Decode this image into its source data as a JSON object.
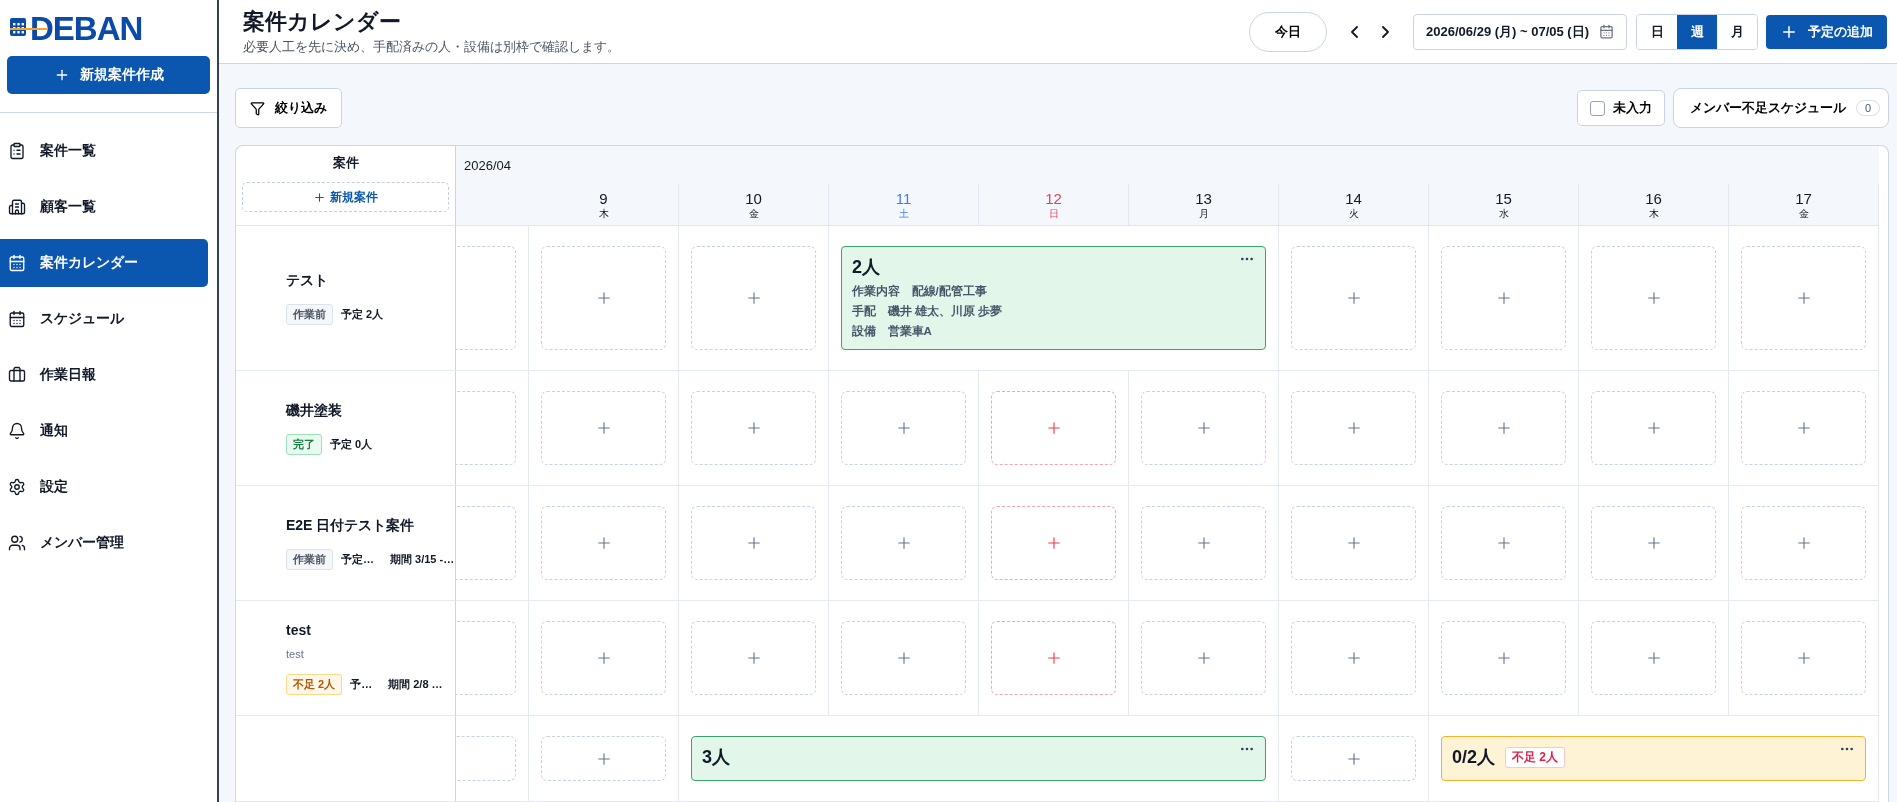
{
  "sidebar": {
    "logo": "DEBAN",
    "new_button": "新規案件作成",
    "items": [
      {
        "label": "案件一覧",
        "kind": "clipboard",
        "selected": false
      },
      {
        "label": "顧客一覧",
        "kind": "building",
        "selected": false
      },
      {
        "label": "案件カレンダー",
        "kind": "calendar",
        "selected": true
      },
      {
        "label": "スケジュール",
        "kind": "calendar",
        "selected": false
      },
      {
        "label": "作業日報",
        "kind": "briefcase",
        "selected": false
      },
      {
        "label": "通知",
        "kind": "bell",
        "selected": false
      },
      {
        "label": "設定",
        "kind": "gear",
        "selected": false
      },
      {
        "label": "メンバー管理",
        "kind": "users",
        "selected": false
      }
    ]
  },
  "header": {
    "title": "案件カレンダー",
    "subtitle": "必要人工を先に決め、手配済みの人・設備は別枠で確認します。",
    "today": "今日",
    "date_range": "2026/06/29 (月) ~ 07/05 (日)",
    "views": [
      {
        "label": "日",
        "selected": false
      },
      {
        "label": "週",
        "selected": true
      },
      {
        "label": "月",
        "selected": false
      }
    ],
    "add_button": "予定の追加"
  },
  "toolbar": {
    "filter": "絞り込み",
    "unfilled": {
      "label": "未入力",
      "checked": false
    },
    "shortage": {
      "label": "メンバー不足スケジュール",
      "count": "0"
    }
  },
  "calendar": {
    "project_heading": "案件",
    "new_project": "新規案件",
    "month": "2026/04",
    "days": [
      {
        "day": "9",
        "weekday": "木",
        "kind": "weekday"
      },
      {
        "day": "10",
        "weekday": "金",
        "kind": "weekday"
      },
      {
        "day": "11",
        "weekday": "土",
        "kind": "saturday"
      },
      {
        "day": "12",
        "weekday": "日",
        "kind": "sunday"
      },
      {
        "day": "13",
        "weekday": "月",
        "kind": "weekday"
      },
      {
        "day": "14",
        "weekday": "火",
        "kind": "weekday"
      },
      {
        "day": "15",
        "weekday": "水",
        "kind": "weekday"
      },
      {
        "day": "16",
        "weekday": "木",
        "kind": "weekday"
      },
      {
        "day": "17",
        "weekday": "金",
        "kind": "weekday"
      }
    ],
    "rows": [
      {
        "name": "テスト",
        "status": {
          "label": "作業前",
          "kind": "before"
        },
        "planned": "予定 2人",
        "cells": [
          {
            "kind": "slot"
          },
          {
            "kind": "slot"
          },
          {
            "kind": "event_ok",
            "title": "2人",
            "lines": [
              {
                "label": "作業内容",
                "value": "配線/配管工事"
              },
              {
                "label": "手配",
                "value": "磯井 雄太、川原 歩夢"
              },
              {
                "label": "設備",
                "value": "営業車A"
              }
            ]
          },
          {
            "kind": "more"
          },
          {
            "kind": "more"
          },
          {
            "kind": "slot"
          },
          {
            "kind": "slot"
          },
          {
            "kind": "slot"
          },
          {
            "kind": "slot"
          }
        ]
      },
      {
        "name": "磯井塗装",
        "status": {
          "label": "完了",
          "kind": "done"
        },
        "planned": "予定 0人",
        "cells": [
          {
            "kind": "slot"
          },
          {
            "kind": "slot"
          },
          {
            "kind": "slot"
          },
          {
            "kind": "slot"
          },
          {
            "kind": "slot"
          },
          {
            "kind": "slot"
          },
          {
            "kind": "slot"
          },
          {
            "kind": "slot"
          },
          {
            "kind": "slot"
          }
        ]
      },
      {
        "name": "E2E 日付テスト案件",
        "status": {
          "label": "作業前",
          "kind": "before"
        },
        "planned": "予定…",
        "period": "期間 3/15 -…",
        "cells": [
          {
            "kind": "slot"
          },
          {
            "kind": "slot"
          },
          {
            "kind": "slot"
          },
          {
            "kind": "slot"
          },
          {
            "kind": "slot"
          },
          {
            "kind": "slot"
          },
          {
            "kind": "slot"
          },
          {
            "kind": "slot"
          },
          {
            "kind": "slot"
          }
        ]
      },
      {
        "name": "test",
        "note": "test",
        "status": {
          "label": "不足 2人",
          "kind": "short"
        },
        "planned": "予…",
        "period": "期間 2/8 …",
        "cells": [
          {
            "kind": "slot"
          },
          {
            "kind": "slot"
          },
          {
            "kind": "slot"
          },
          {
            "kind": "slot"
          },
          {
            "kind": "slot"
          },
          {
            "kind": "slot"
          },
          {
            "kind": "slot"
          },
          {
            "kind": "slot"
          },
          {
            "kind": "slot"
          }
        ]
      },
      {
        "cells": [
          {
            "kind": "slot"
          },
          {
            "kind": "event_ok",
            "title": "3人"
          },
          {
            "kind": "more"
          },
          {
            "kind": "more"
          },
          {
            "kind": "more"
          },
          {
            "kind": "slot"
          },
          {
            "kind": "event_short",
            "title": "0/2人",
            "badge": "不足 2人"
          },
          {
            "kind": "more"
          },
          {
            "kind": "more"
          }
        ]
      }
    ]
  }
}
